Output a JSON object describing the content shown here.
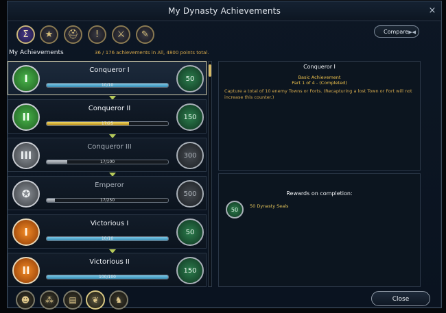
{
  "window": {
    "title": "My Dynasty Achievements",
    "close_glyph": "×"
  },
  "header": {
    "categories": [
      {
        "icon": "sigma-icon",
        "glyph": "Σ"
      },
      {
        "icon": "star-icon",
        "glyph": "★"
      },
      {
        "icon": "helmet-icon",
        "glyph": "⛑"
      },
      {
        "icon": "warning-icon",
        "glyph": "!"
      },
      {
        "icon": "crossed-swords-icon",
        "glyph": "⚔"
      },
      {
        "icon": "scroll-icon",
        "glyph": "✎"
      }
    ],
    "compare_label": "Compare",
    "compare_arrow": "▶◀"
  },
  "list": {
    "heading": "My Achievements",
    "summary": "36 / 176 achievements in All, 4800 points total.",
    "items": [
      {
        "name": "Conqueror I",
        "progress": "10/10",
        "fraction": 1.0,
        "reward": "50",
        "medal": "green",
        "numeral": "I",
        "completed": true
      },
      {
        "name": "Conqueror II",
        "progress": "17/25",
        "fraction": 0.68,
        "reward": "150",
        "medal": "green",
        "numeral": "II",
        "completed": false
      },
      {
        "name": "Conqueror III",
        "progress": "17/100",
        "fraction": 0.17,
        "reward": "300",
        "medal": "gray",
        "numeral": "III",
        "completed": false
      },
      {
        "name": "Emperor",
        "progress": "17/250",
        "fraction": 0.068,
        "reward": "500",
        "medal": "gray",
        "numeral": "",
        "completed": false
      },
      {
        "name": "Victorious I",
        "progress": "10/10",
        "fraction": 1.0,
        "reward": "50",
        "medal": "orange",
        "numeral": "I",
        "completed": true
      },
      {
        "name": "Victorious II",
        "progress": "100/100",
        "fraction": 1.0,
        "reward": "150",
        "medal": "orange",
        "numeral": "II",
        "completed": true
      }
    ]
  },
  "detail": {
    "title": "Conqueror I",
    "type_line": "Basic Achievement",
    "part_line": "Part 1 of 4 - (Completed)",
    "description": "Capture a total of 10 enemy Towns or Forts. (Recapturing a lost Town or Fort will not increase this counter.)"
  },
  "rewards": {
    "title": "Rewards on completion:",
    "coin": "50",
    "text": "50 Dynasty Seals"
  },
  "bottom": {
    "icons": [
      {
        "icon": "character-icon",
        "glyph": "☻"
      },
      {
        "icon": "dynasty-tree-icon",
        "glyph": "⁂"
      },
      {
        "icon": "book-icon",
        "glyph": "▤"
      },
      {
        "icon": "laurel-icon",
        "glyph": "❦"
      },
      {
        "icon": "soldiers-icon",
        "glyph": "♞"
      }
    ],
    "close_label": "Close"
  },
  "colors": {
    "accent_gold": "#d4a94e",
    "progress_blue": "#3890b8",
    "progress_gold": "#d6b43a"
  }
}
